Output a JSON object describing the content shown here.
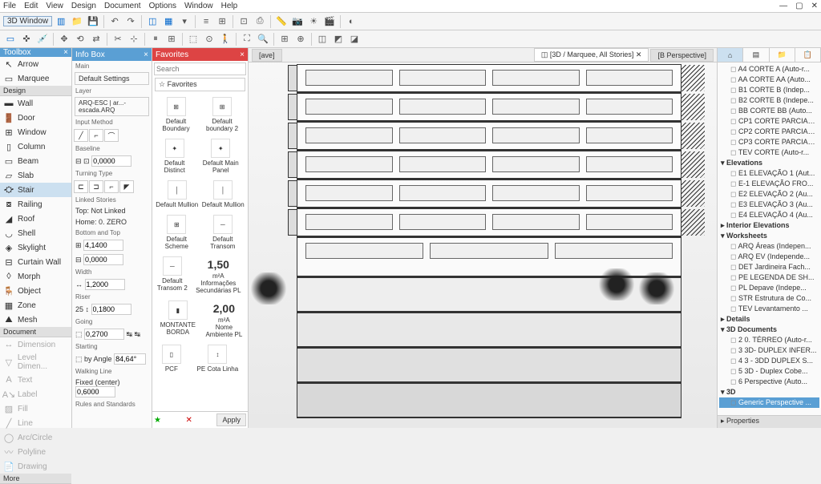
{
  "menu": [
    "File",
    "Edit",
    "View",
    "Design",
    "Document",
    "Options",
    "Window",
    "Help"
  ],
  "window3d_label": "3D Window",
  "toolbox": {
    "title": "Toolbox",
    "arrow": "Arrow",
    "marquee": "Marquee",
    "sect_design": "Design",
    "wall": "Wall",
    "door": "Door",
    "window": "Window",
    "column": "Column",
    "beam": "Beam",
    "slab": "Slab",
    "stair": "Stair",
    "railing": "Railing",
    "roof": "Roof",
    "shell": "Shell",
    "skylight": "Skylight",
    "curtain": "Curtain Wall",
    "morph": "Morph",
    "object": "Object",
    "zone": "Zone",
    "mesh": "Mesh",
    "sect_doc": "Document",
    "dimension": "Dimension",
    "leveldim": "Level Dimen...",
    "text": "Text",
    "label": "Label",
    "fill": "Fill",
    "line": "Line",
    "arc": "Arc/Circle",
    "polyline": "Polyline",
    "drawing": "Drawing",
    "more": "More"
  },
  "infobox": {
    "title": "Info Box",
    "main": "Main",
    "default": "Default Settings",
    "layer": "Layer",
    "layer_val": "ARQ-ESC | ar...-escada.ARQ",
    "input": "Input Method",
    "baseline": "Baseline",
    "baseline_val": "0,0000",
    "turning": "Turning Type",
    "linked": "Linked Stories",
    "top": "Top:",
    "top_val": "Not Linked",
    "home": "Home:",
    "home_val": "0. ZERO",
    "bottomtop": "Bottom and Top",
    "v1": "4,1400",
    "v2": "0,0000",
    "width": "Width",
    "width_val": "1,2000",
    "riser": "Riser",
    "riser_n": "25",
    "riser_v": "0,1800",
    "going": "Going",
    "going_v": "0,2700",
    "starting": "Starting",
    "byangle": "by Angle",
    "angle_v": "84,64°",
    "walking": "Walking Line",
    "fixed": "Fixed (center)",
    "fixed_v": "0,6000",
    "rules": "Rules and Standards"
  },
  "favorites": {
    "title": "Favorites",
    "search_ph": "Search",
    "favs": "Favorites",
    "items": [
      [
        "Default Boundary",
        "Default boundary 2"
      ],
      [
        "Default Distinct",
        "Default Main Panel"
      ],
      [
        "Default Mullion",
        "Default Mullion"
      ],
      [
        "Default Scheme",
        "Default Transom"
      ]
    ],
    "big1": "1,50",
    "big1_unit": "m²A",
    "info1": "Informações Secundárias PL",
    "transom2": "Default Transom 2",
    "big2": "2,00",
    "big2_unit": "m²A",
    "info2": "Nome Ambiente PL",
    "montante": "MONTANTE BORDA",
    "pcf": "PCF",
    "cota": "PE Cota Linha",
    "apply": "Apply"
  },
  "tabs": {
    "t1": "[ave]",
    "t2": "[3D / Marquee, All Stories]",
    "t3": "[B Perspective]"
  },
  "navigator": {
    "cortes": [
      "A4 CORTE A (Auto-r...",
      "AA CORTE AA (Auto...",
      "B1 CORTE B (Indep...",
      "B2 CORTE B (Indepe...",
      "BB CORTE BB (Auto...",
      "CP1 CORTE PARCIAL...",
      "CP2 CORTE PARCIAL...",
      "CP3 CORTE PARCIAL...",
      "TEV CORTE (Auto-r..."
    ],
    "elev_grp": "Elevations",
    "elevs": [
      "E1 ELEVAÇÃO 1 (Aut...",
      "E-1 ELEVAÇÃO FRO...",
      "E2 ELEVAÇÃO 2 (Au...",
      "E3 ELEVAÇÃO 3 (Au...",
      "E4 ELEVAÇÃO 4 (Au..."
    ],
    "intelev": "Interior Elevations",
    "ws_grp": "Worksheets",
    "ws": [
      "ARQ Áreas (Indepen...",
      "ARQ EV (Independe...",
      "DET Jardineira Fach...",
      "PE LEGENDA DE SH...",
      "PL Depave (Indepe...",
      "STR Estrutura de Co...",
      "TEV Levantamento ..."
    ],
    "details": "Details",
    "d3docs": "3D Documents",
    "d3items": [
      "2 0. TÉRREO (Auto-r...",
      "3 3D- DUPLEX INFER...",
      "4 3 - 3DD DUPLEX S...",
      "5 3D - Duplex Cobe...",
      "6 Perspective (Auto..."
    ],
    "d3": "3D",
    "generic": "Generic Perspective ...",
    "props": "Properties"
  }
}
